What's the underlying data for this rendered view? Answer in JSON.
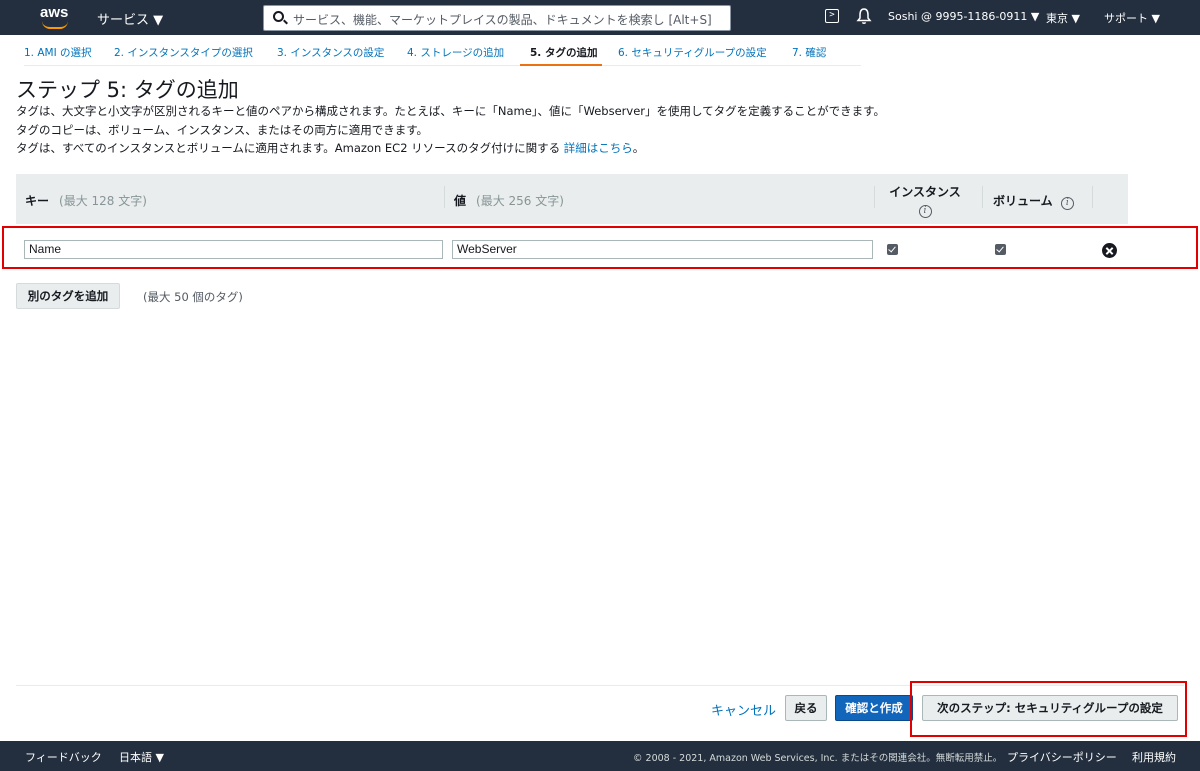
{
  "topnav": {
    "logo_text": "aws",
    "services_label": "サービス ▼",
    "search_placeholder": "サービス、機能、マーケットプレイスの製品、ドキュメントを検索し [Alt+S]",
    "account_label": "Soshi @ 9995-1186-0911 ▼",
    "region_label": "東京 ▼",
    "support_label": "サポート ▼"
  },
  "steps": [
    {
      "label": "1. AMI の選択",
      "active": false
    },
    {
      "label": "2. インスタンスタイプの選択",
      "active": false
    },
    {
      "label": "3. インスタンスの設定",
      "active": false
    },
    {
      "label": "4. ストレージの追加",
      "active": false
    },
    {
      "label": "5. タグの追加",
      "active": true
    },
    {
      "label": "6. セキュリティグループの設定",
      "active": false
    },
    {
      "label": "7. 確認",
      "active": false
    }
  ],
  "page": {
    "title": "ステップ 5: タグの追加",
    "desc_line1": "タグは、大文字と小文字が区別されるキーと値のペアから構成されます。たとえば、キーに「Name」、値に「Webserver」を使用してタグを定義することができます。",
    "desc_line2": "タグのコピーは、ボリューム、インスタンス、またはその両方に適用できます。",
    "desc_line3": "タグは、すべてのインスタンスとボリュームに適用されます。Amazon EC2 リソースのタグ付けに関する",
    "learn_more_link": "詳細はこちら",
    "desc_line3_end": "。"
  },
  "table": {
    "headers": {
      "key": "キー",
      "key_hint": "(最大 128 文字)",
      "value": "値",
      "value_hint": "(最大 256 文字)",
      "instances": "インスタンス",
      "volumes": "ボリューム",
      "info_glyph": "i"
    },
    "rows": [
      {
        "key": "Name",
        "value": "WebServer",
        "instances": true,
        "volumes": true
      }
    ],
    "add_tag_label": "別のタグを追加",
    "max_tags_label": "(最大 50 個のタグ)"
  },
  "actions": {
    "cancel_label": "キャンセル",
    "back_label": "戻る",
    "review_launch_label": "確認と作成",
    "next_label": "次のステップ: セキュリティグループの設定"
  },
  "footer": {
    "feedback_label": "フィードバック",
    "language_label": "日本語 ▼",
    "copyright": "© 2008 - 2021, Amazon Web Services, Inc. またはその関連会社。無断転用禁止。",
    "privacy_label": "プライバシーポリシー",
    "terms_label": "利用規約"
  },
  "colors": {
    "nav_bg": "#232f3e",
    "link": "#0073bb",
    "active_tab": "#ec7211",
    "primary_button": "#1166bb",
    "highlight": "#e00000"
  }
}
